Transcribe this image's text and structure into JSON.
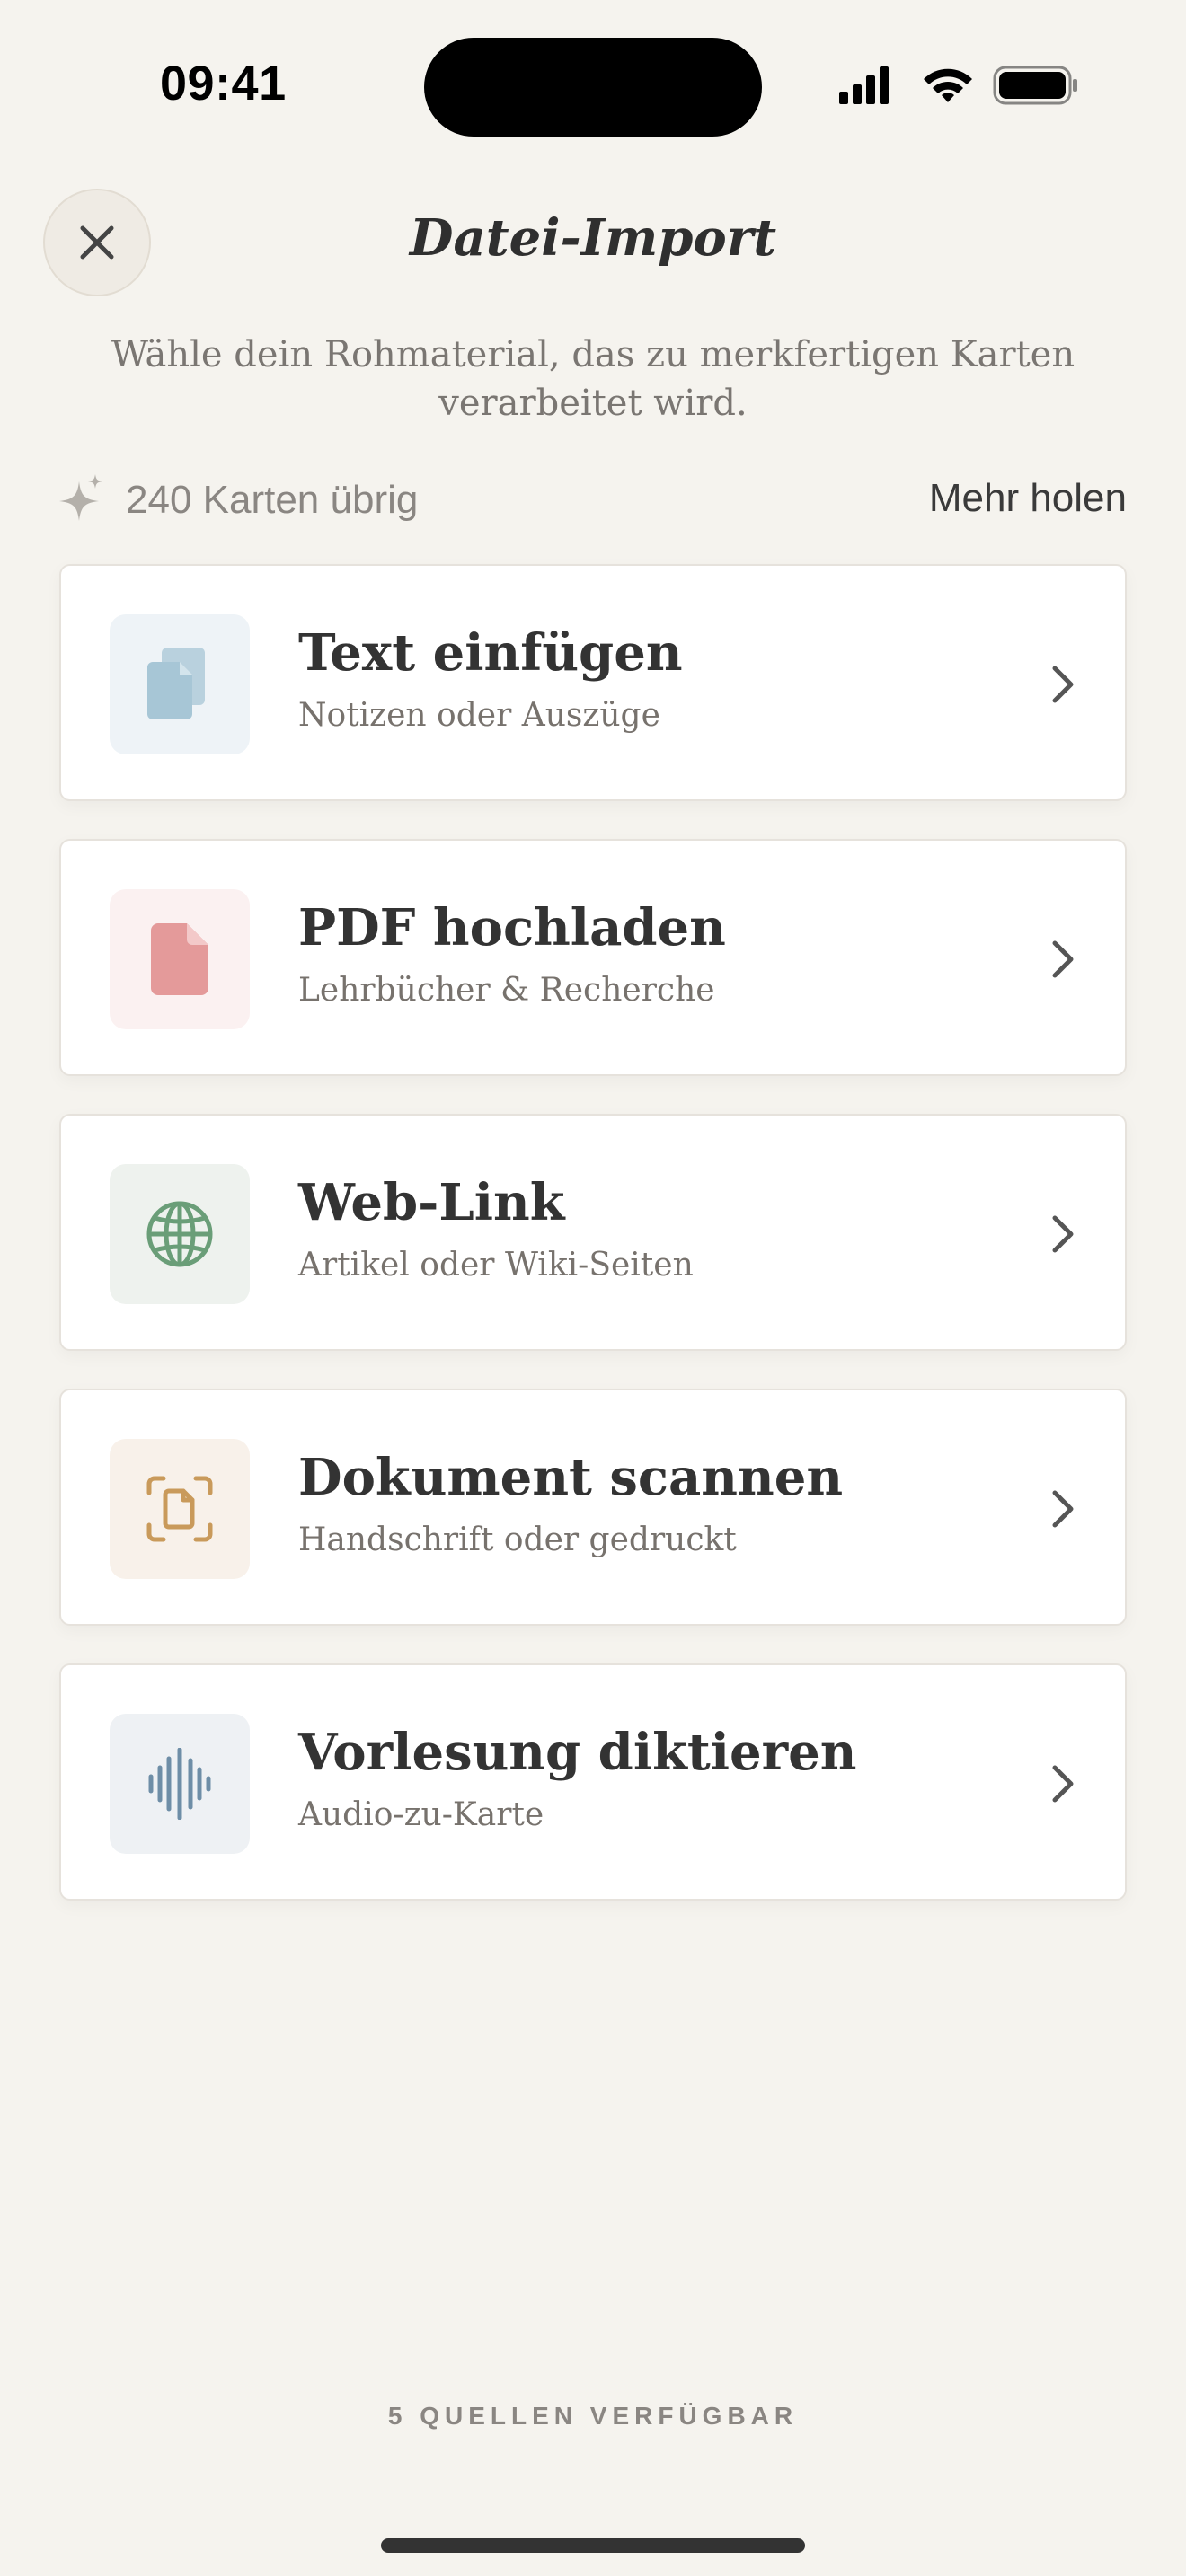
{
  "status_bar": {
    "time": "09:41"
  },
  "header": {
    "title": "Datei-Import",
    "subtitle_line1": "Wähle dein Rohmaterial, das zu merkfertigen Karten",
    "subtitle_line2": "verarbeitet wird."
  },
  "credits": {
    "text": "240 Karten übrig",
    "more_label": "Mehr holen"
  },
  "sources": [
    {
      "title": "Text einfügen",
      "subtitle": "Notizen oder Auszüge",
      "icon": "paste-icon",
      "tile_color": "#eef3f7",
      "icon_color": "#a7c6d6"
    },
    {
      "title": "PDF hochladen",
      "subtitle": "Lehrbücher & Recherche",
      "icon": "pdf-icon",
      "tile_color": "#fbf1f1",
      "icon_color": "#e49a9a"
    },
    {
      "title": "Web-Link",
      "subtitle": "Artikel oder Wiki-Seiten",
      "icon": "globe-icon",
      "tile_color": "#eef2ee",
      "icon_color": "#6a9e78"
    },
    {
      "title": "Dokument scannen",
      "subtitle": "Handschrift oder gedruckt",
      "icon": "scan-icon",
      "tile_color": "#f8f1ea",
      "icon_color": "#c99a5b"
    },
    {
      "title": "Vorlesung diktieren",
      "subtitle": "Audio-zu-Karte",
      "icon": "waveform-icon",
      "tile_color": "#eef1f4",
      "icon_color": "#6e8ea7"
    }
  ],
  "footer": {
    "text": "5 QUELLEN VERFÜGBAR"
  }
}
